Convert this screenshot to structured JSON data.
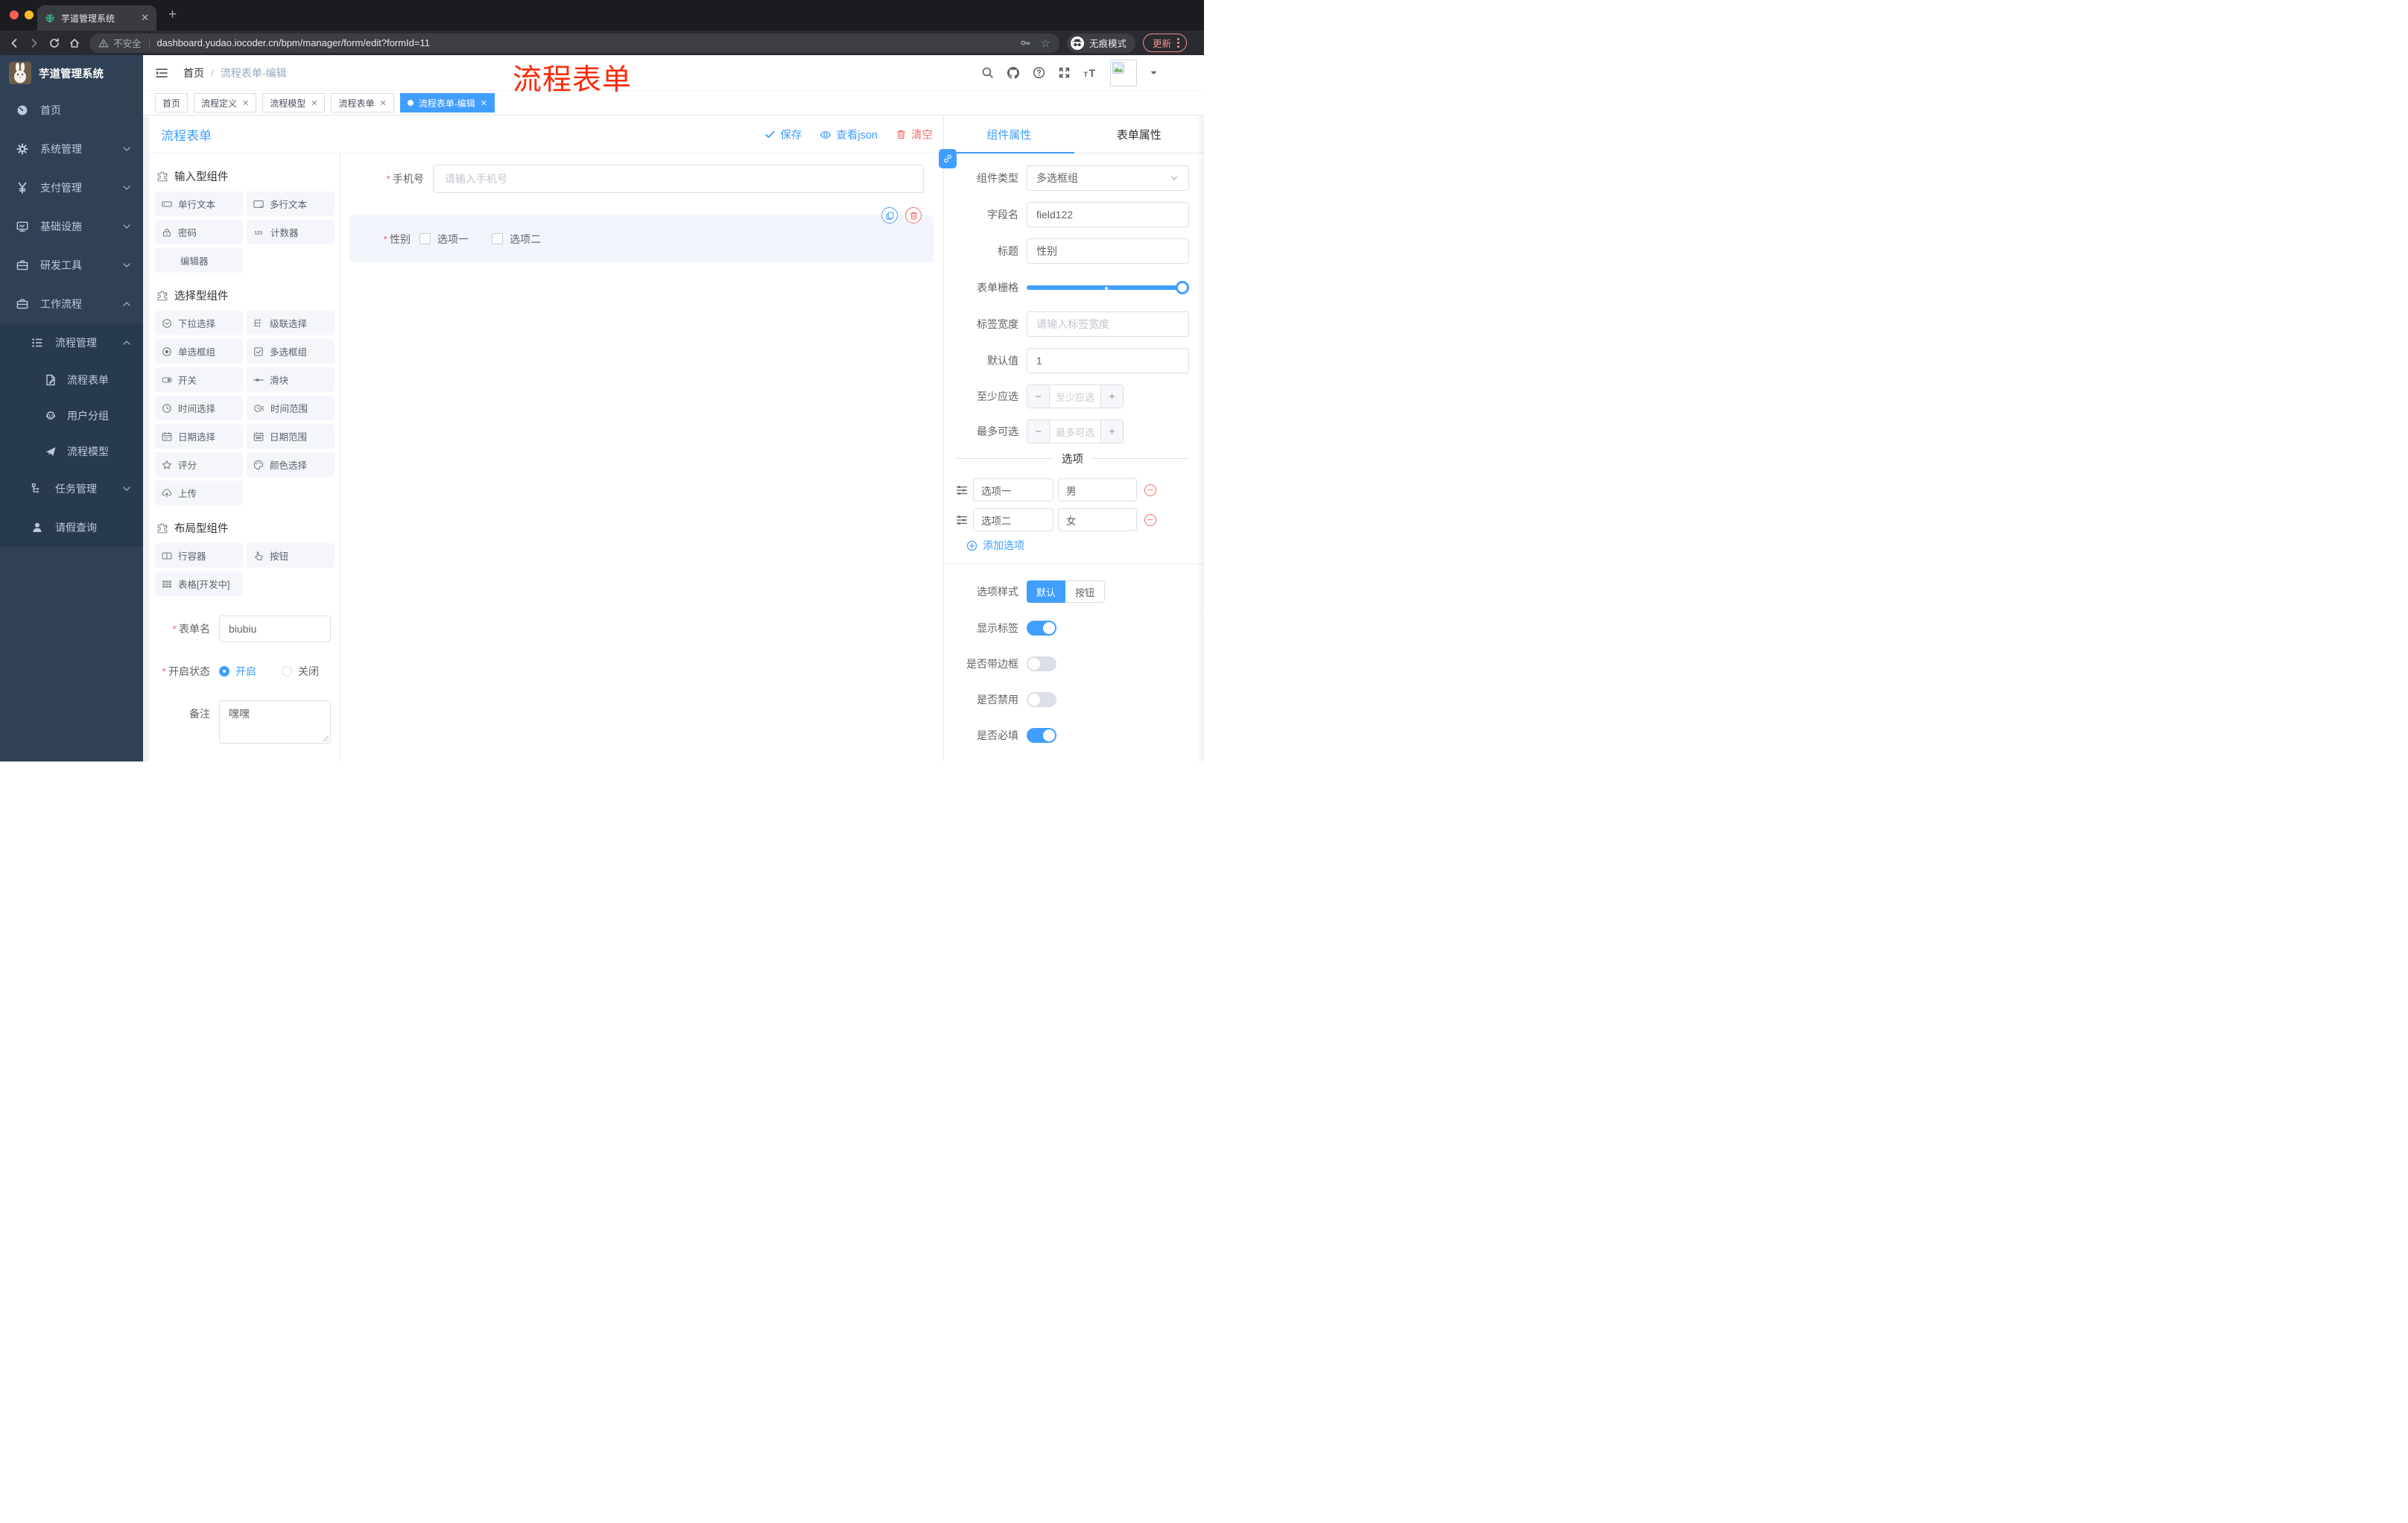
{
  "colors": {
    "accent": "#409eff",
    "danger": "#f56c6c",
    "annotation_red": "#fb2a08",
    "sidebar_bg": "#304156"
  },
  "browser": {
    "tab_title": "芋道管理系统",
    "security_label": "不安全",
    "url": "dashboard.yudao.iocoder.cn/bpm/manager/form/edit?formId=11",
    "incognito_label": "无痕模式",
    "update_label": "更新"
  },
  "sidebar": {
    "logo_title": "芋道管理系统",
    "items": [
      {
        "label": "首页",
        "icon": "dashboard-icon"
      },
      {
        "label": "系统管理",
        "icon": "gear-icon"
      },
      {
        "label": "支付管理",
        "icon": "yen-icon"
      },
      {
        "label": "基础设施",
        "icon": "monitor-icon"
      },
      {
        "label": "研发工具",
        "icon": "toolbox-icon"
      },
      {
        "label": "工作流程",
        "icon": "briefcase-icon"
      }
    ],
    "submenu": {
      "group": "流程管理",
      "children": [
        "流程表单",
        "用户分组",
        "流程模型"
      ],
      "task_group": "任务管理",
      "leave_item": "请假查询"
    }
  },
  "header": {
    "breadcrumb_home": "首页",
    "breadcrumb_sep": "/",
    "breadcrumb_current": "流程表单-编辑"
  },
  "annotation": {
    "text": "流程表单"
  },
  "tags": [
    {
      "label": "首页"
    },
    {
      "label": "流程定义"
    },
    {
      "label": "流程模型"
    },
    {
      "label": "流程表单"
    },
    {
      "label": "流程表单-编辑"
    }
  ],
  "editor": {
    "title": "流程表单",
    "save_label": "保存",
    "view_json_label": "查看json",
    "clear_label": "清空"
  },
  "palette": {
    "sections": [
      {
        "title": "输入型组件",
        "items": [
          {
            "icon": "input-icon",
            "label": "单行文本"
          },
          {
            "icon": "textarea-icon",
            "label": "多行文本"
          },
          {
            "icon": "password-icon",
            "label": "密码"
          },
          {
            "icon": "counter-icon",
            "label": "计数器"
          },
          {
            "icon": "editor-icon",
            "label": "编辑器"
          }
        ]
      },
      {
        "title": "选择型组件",
        "items": [
          {
            "icon": "select-icon",
            "label": "下拉选择"
          },
          {
            "icon": "cascader-icon",
            "label": "级联选择"
          },
          {
            "icon": "radio-group-icon",
            "label": "单选框组"
          },
          {
            "icon": "checkbox-group-icon",
            "label": "多选框组"
          },
          {
            "icon": "switch-icon",
            "label": "开关"
          },
          {
            "icon": "slider-icon",
            "label": "滑块"
          },
          {
            "icon": "time-icon",
            "label": "时间选择"
          },
          {
            "icon": "time-range-icon",
            "label": "时间范围"
          },
          {
            "icon": "date-icon",
            "label": "日期选择"
          },
          {
            "icon": "date-range-icon",
            "label": "日期范围"
          },
          {
            "icon": "rate-icon",
            "label": "评分"
          },
          {
            "icon": "color-icon",
            "label": "颜色选择"
          },
          {
            "icon": "upload-icon",
            "label": "上传"
          }
        ]
      },
      {
        "title": "布局型组件",
        "items": [
          {
            "icon": "row-icon",
            "label": "行容器"
          },
          {
            "icon": "button-icon",
            "label": "按钮"
          },
          {
            "icon": "table-icon",
            "label": "表格[开发中]"
          }
        ]
      }
    ]
  },
  "form_meta": {
    "name_label": "表单名",
    "name_value": "biubiu",
    "status_label": "开启状态",
    "status_on": "开启",
    "status_off": "关闭",
    "remark_label": "备注",
    "remark_value": "嘿嘿"
  },
  "canvas": {
    "phone": {
      "label": "手机号",
      "placeholder": "请输入手机号"
    },
    "gender": {
      "label": "性别",
      "options": [
        "选项一",
        "选项二"
      ]
    }
  },
  "props": {
    "tab_component": "组件属性",
    "tab_form": "表单属性",
    "component_type_label": "组件类型",
    "component_type_value": "多选框组",
    "field_label": "字段名",
    "field_value": "field122",
    "title_label": "标题",
    "title_value": "性别",
    "grid_label": "表单栅格",
    "label_width_label": "标签宽度",
    "label_width_placeholder": "请输入标签宽度",
    "default_label": "默认值",
    "default_value": "1",
    "min_label": "至少应选",
    "min_placeholder": "至少应选",
    "max_label": "最多可选",
    "max_placeholder": "最多可选",
    "options_title": "选项",
    "options": [
      {
        "label": "选项一",
        "value": "男"
      },
      {
        "label": "选项二",
        "value": "女"
      }
    ],
    "add_option_label": "添加选项",
    "style_label": "选项样式",
    "style_default": "默认",
    "style_button": "按钮",
    "toggle_show_label": "显示标签",
    "toggle_border": "是否带边框",
    "toggle_disabled": "是否禁用",
    "toggle_required": "是否必填"
  }
}
